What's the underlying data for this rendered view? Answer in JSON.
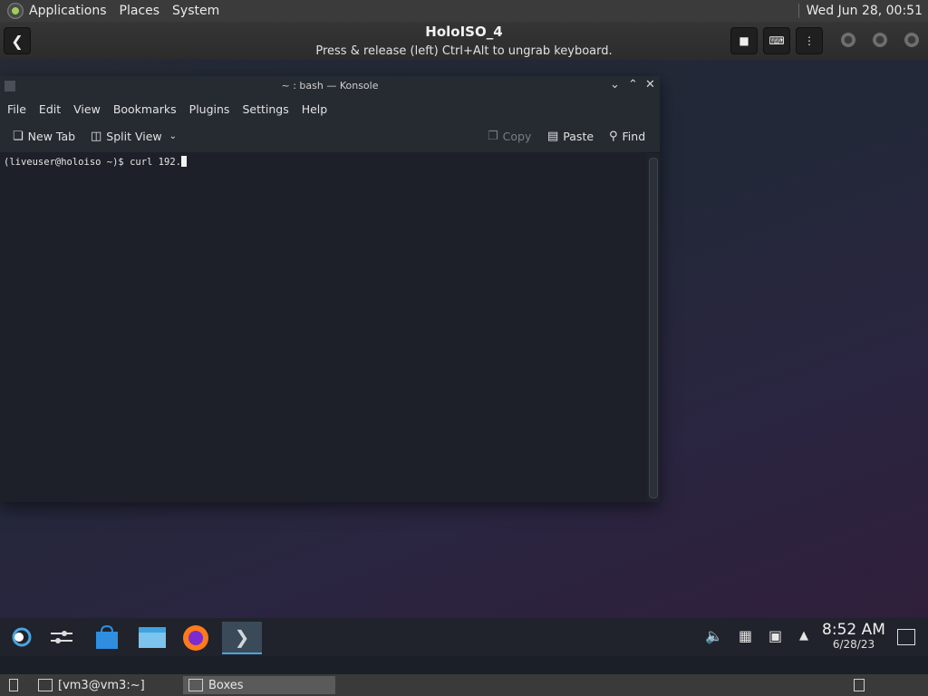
{
  "host_panel": {
    "menus": [
      "Applications",
      "Places",
      "System"
    ],
    "clock": "Wed Jun 28, 00:51",
    "logo_icon": "app-menu-logo-icon"
  },
  "boxes_header": {
    "title": "HoloISO_4",
    "subtitle": "Press & release (left) Ctrl+Alt to ungrab keyboard.",
    "back_icon": "back-arrow-icon",
    "buttons": [
      "stop-icon",
      "keyboard-icon",
      "menu-kebab-icon"
    ]
  },
  "konsole": {
    "title": "~ : bash — Konsole",
    "menu": [
      "File",
      "Edit",
      "View",
      "Bookmarks",
      "Plugins",
      "Settings",
      "Help"
    ],
    "toolbar": {
      "new_tab": "New Tab",
      "split_view": "Split View",
      "copy": "Copy",
      "paste": "Paste",
      "find": "Find"
    },
    "prompt": "(liveuser@holoiso ~)$ curl 192."
  },
  "guest_taskbar": {
    "apps": [
      "steam-icon",
      "settings-icon",
      "discover-store-icon",
      "file-manager-icon",
      "firefox-icon",
      "konsole-icon"
    ],
    "time": "8:52 AM",
    "date": "6/28/23"
  },
  "host_bottom": {
    "tasks": [
      "[vm3@vm3:~]",
      "Boxes"
    ]
  },
  "colors": {
    "accent": "#4aa3df",
    "terminal_bg": "#1d2028",
    "panel_bg": "#3a3a3a"
  }
}
